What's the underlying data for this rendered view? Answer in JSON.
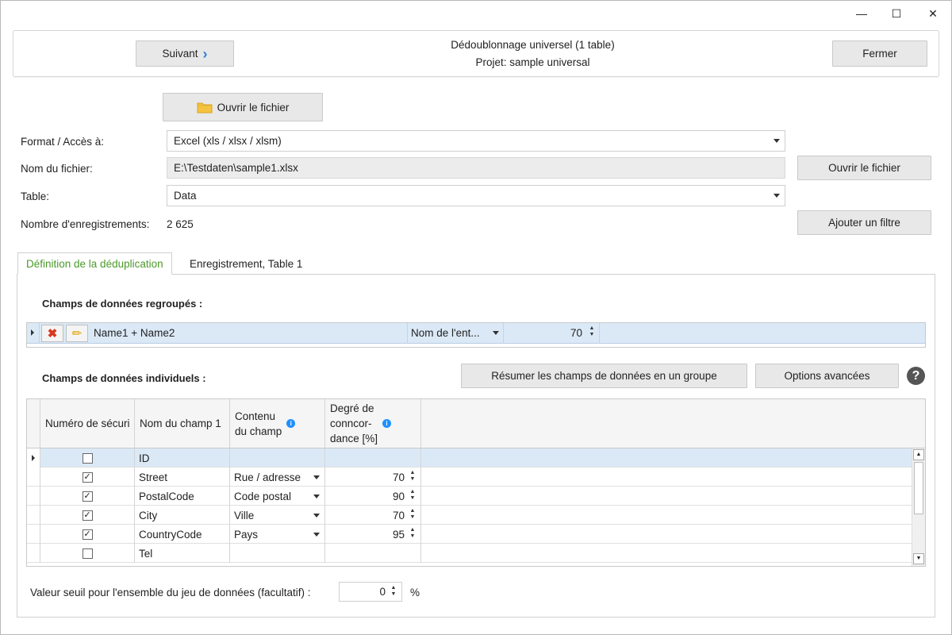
{
  "window": {
    "minimize": "—",
    "maximize": "☐",
    "close": "✕"
  },
  "header": {
    "next_label": "Suivant",
    "next_chevron": "›",
    "title": "Dédoublonnage universel (1 table)",
    "project": "Projet: sample universal",
    "close_label": "Fermer"
  },
  "open_file_top": "Ouvrir le fichier",
  "form": {
    "format_label": "Format / Accès à:",
    "format_value": "Excel (xls / xlsx / xlsm)",
    "filename_label": "Nom du fichier:",
    "filename_value": "E:\\Testdaten\\sample1.xlsx",
    "open_file_label": "Ouvrir le fichier",
    "table_label": "Table:",
    "table_value": "Data",
    "count_label": "Nombre d'enregistrements:",
    "count_value": "2 625",
    "add_filter_label": "Ajouter un filtre"
  },
  "tabs": [
    {
      "label": "Définition de la déduplication"
    },
    {
      "label": "Enregistrement, Table 1"
    }
  ],
  "grouped": {
    "title": "Champs de données regroupés :",
    "row": {
      "fields": "Name1 + Name2",
      "content": "Nom de l'ent...",
      "degree": "70"
    }
  },
  "individual": {
    "title": "Champs de données individuels :",
    "summarize_label": "Résumer les champs de données en un groupe",
    "advanced_label": "Options avancées",
    "help": "?",
    "headers": {
      "col1": "Numéro de sécuri",
      "col2": "Nom du champ 1",
      "col3_line1": "Contenu",
      "col3_line2": "du champ",
      "col4_line1": "Degré de",
      "col4_line2": "conncor-",
      "col4_line3": "dance [%]"
    },
    "rows": [
      {
        "checked": "",
        "name": "ID",
        "content": "",
        "degree": ""
      },
      {
        "checked": "✓",
        "name": "Street",
        "content": "Rue / adresse",
        "degree": "70"
      },
      {
        "checked": "✓",
        "name": "PostalCode",
        "content": "Code postal",
        "degree": "90"
      },
      {
        "checked": "✓",
        "name": "City",
        "content": "Ville",
        "degree": "70"
      },
      {
        "checked": "✓",
        "name": "CountryCode",
        "content": "Pays",
        "degree": "95"
      },
      {
        "checked": "",
        "name": "Tel",
        "content": "",
        "degree": ""
      }
    ]
  },
  "threshold": {
    "label": "Valeur seuil pour l'ensemble du jeu de données (facultatif) :",
    "value": "0",
    "unit": "%"
  },
  "colors": {
    "accent_green": "#4a9a2a",
    "selection": "#dbe9f7",
    "info_blue": "#1e90ff",
    "delete_red": "#d9381e",
    "folder_yellow": "#f5c342"
  }
}
